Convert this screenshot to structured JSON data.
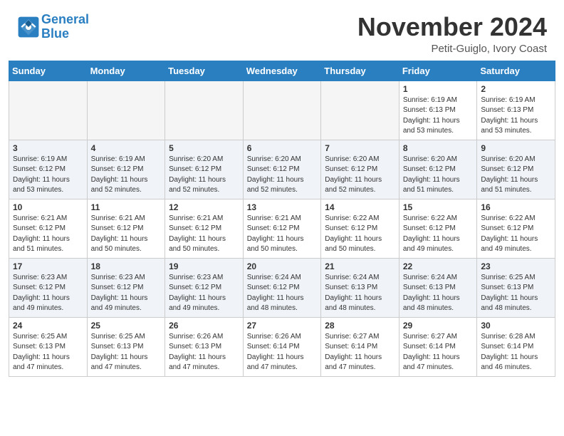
{
  "header": {
    "logo_line1": "General",
    "logo_line2": "Blue",
    "month": "November 2024",
    "location": "Petit-Guiglo, Ivory Coast"
  },
  "weekdays": [
    "Sunday",
    "Monday",
    "Tuesday",
    "Wednesday",
    "Thursday",
    "Friday",
    "Saturday"
  ],
  "weeks": [
    [
      {
        "day": "",
        "info": ""
      },
      {
        "day": "",
        "info": ""
      },
      {
        "day": "",
        "info": ""
      },
      {
        "day": "",
        "info": ""
      },
      {
        "day": "",
        "info": ""
      },
      {
        "day": "1",
        "info": "Sunrise: 6:19 AM\nSunset: 6:13 PM\nDaylight: 11 hours and 53 minutes."
      },
      {
        "day": "2",
        "info": "Sunrise: 6:19 AM\nSunset: 6:13 PM\nDaylight: 11 hours and 53 minutes."
      }
    ],
    [
      {
        "day": "3",
        "info": "Sunrise: 6:19 AM\nSunset: 6:12 PM\nDaylight: 11 hours and 53 minutes."
      },
      {
        "day": "4",
        "info": "Sunrise: 6:19 AM\nSunset: 6:12 PM\nDaylight: 11 hours and 52 minutes."
      },
      {
        "day": "5",
        "info": "Sunrise: 6:20 AM\nSunset: 6:12 PM\nDaylight: 11 hours and 52 minutes."
      },
      {
        "day": "6",
        "info": "Sunrise: 6:20 AM\nSunset: 6:12 PM\nDaylight: 11 hours and 52 minutes."
      },
      {
        "day": "7",
        "info": "Sunrise: 6:20 AM\nSunset: 6:12 PM\nDaylight: 11 hours and 52 minutes."
      },
      {
        "day": "8",
        "info": "Sunrise: 6:20 AM\nSunset: 6:12 PM\nDaylight: 11 hours and 51 minutes."
      },
      {
        "day": "9",
        "info": "Sunrise: 6:20 AM\nSunset: 6:12 PM\nDaylight: 11 hours and 51 minutes."
      }
    ],
    [
      {
        "day": "10",
        "info": "Sunrise: 6:21 AM\nSunset: 6:12 PM\nDaylight: 11 hours and 51 minutes."
      },
      {
        "day": "11",
        "info": "Sunrise: 6:21 AM\nSunset: 6:12 PM\nDaylight: 11 hours and 50 minutes."
      },
      {
        "day": "12",
        "info": "Sunrise: 6:21 AM\nSunset: 6:12 PM\nDaylight: 11 hours and 50 minutes."
      },
      {
        "day": "13",
        "info": "Sunrise: 6:21 AM\nSunset: 6:12 PM\nDaylight: 11 hours and 50 minutes."
      },
      {
        "day": "14",
        "info": "Sunrise: 6:22 AM\nSunset: 6:12 PM\nDaylight: 11 hours and 50 minutes."
      },
      {
        "day": "15",
        "info": "Sunrise: 6:22 AM\nSunset: 6:12 PM\nDaylight: 11 hours and 49 minutes."
      },
      {
        "day": "16",
        "info": "Sunrise: 6:22 AM\nSunset: 6:12 PM\nDaylight: 11 hours and 49 minutes."
      }
    ],
    [
      {
        "day": "17",
        "info": "Sunrise: 6:23 AM\nSunset: 6:12 PM\nDaylight: 11 hours and 49 minutes."
      },
      {
        "day": "18",
        "info": "Sunrise: 6:23 AM\nSunset: 6:12 PM\nDaylight: 11 hours and 49 minutes."
      },
      {
        "day": "19",
        "info": "Sunrise: 6:23 AM\nSunset: 6:12 PM\nDaylight: 11 hours and 49 minutes."
      },
      {
        "day": "20",
        "info": "Sunrise: 6:24 AM\nSunset: 6:12 PM\nDaylight: 11 hours and 48 minutes."
      },
      {
        "day": "21",
        "info": "Sunrise: 6:24 AM\nSunset: 6:13 PM\nDaylight: 11 hours and 48 minutes."
      },
      {
        "day": "22",
        "info": "Sunrise: 6:24 AM\nSunset: 6:13 PM\nDaylight: 11 hours and 48 minutes."
      },
      {
        "day": "23",
        "info": "Sunrise: 6:25 AM\nSunset: 6:13 PM\nDaylight: 11 hours and 48 minutes."
      }
    ],
    [
      {
        "day": "24",
        "info": "Sunrise: 6:25 AM\nSunset: 6:13 PM\nDaylight: 11 hours and 47 minutes."
      },
      {
        "day": "25",
        "info": "Sunrise: 6:25 AM\nSunset: 6:13 PM\nDaylight: 11 hours and 47 minutes."
      },
      {
        "day": "26",
        "info": "Sunrise: 6:26 AM\nSunset: 6:13 PM\nDaylight: 11 hours and 47 minutes."
      },
      {
        "day": "27",
        "info": "Sunrise: 6:26 AM\nSunset: 6:14 PM\nDaylight: 11 hours and 47 minutes."
      },
      {
        "day": "28",
        "info": "Sunrise: 6:27 AM\nSunset: 6:14 PM\nDaylight: 11 hours and 47 minutes."
      },
      {
        "day": "29",
        "info": "Sunrise: 6:27 AM\nSunset: 6:14 PM\nDaylight: 11 hours and 47 minutes."
      },
      {
        "day": "30",
        "info": "Sunrise: 6:28 AM\nSunset: 6:14 PM\nDaylight: 11 hours and 46 minutes."
      }
    ]
  ]
}
